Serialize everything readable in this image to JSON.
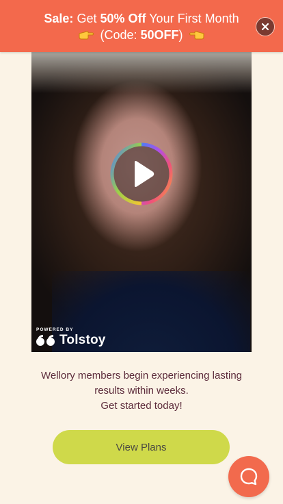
{
  "banner": {
    "sale_label": "Sale:",
    "text_get": "Get",
    "discount": "50% Off",
    "text_rest": "Your First Month",
    "code_prefix": "(Code:",
    "code": "50OFF",
    "code_suffix": ")",
    "background": "#f3694c"
  },
  "video": {
    "powered_by": "POWERED BY",
    "brand": "Tolstoy"
  },
  "caption": {
    "line1": "Wellory members begin experiencing lasting",
    "line2": "results within weeks.",
    "line3": "Get started today!"
  },
  "cta": {
    "label": "View Plans",
    "color": "#cfd94a"
  },
  "chat": {
    "icon": "chat-bubble-icon",
    "color": "#f26a4d"
  }
}
